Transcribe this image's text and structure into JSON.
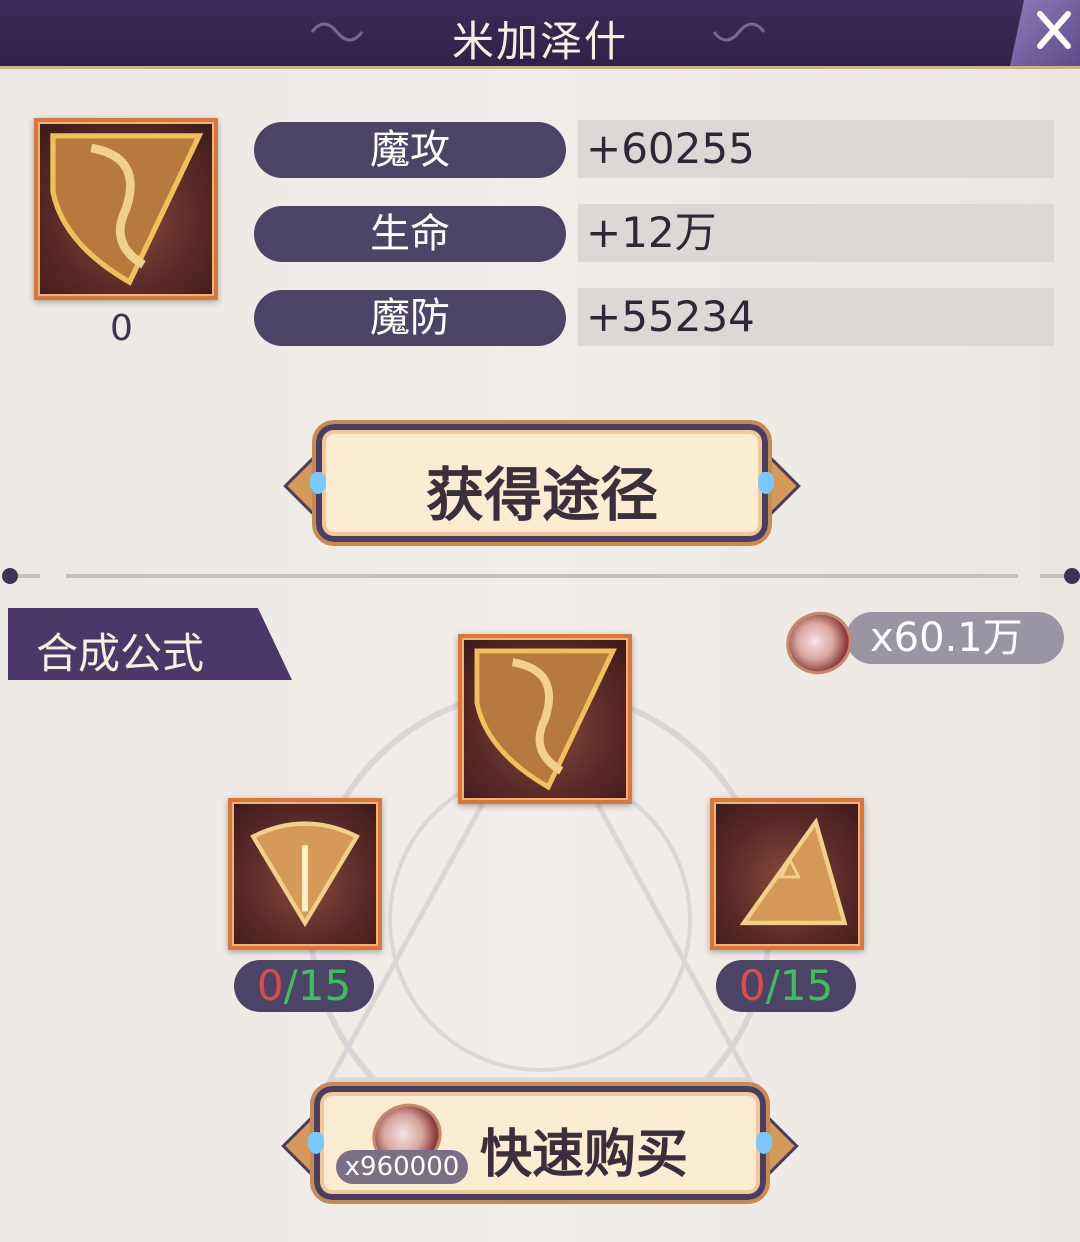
{
  "header": {
    "title": "米加泽什"
  },
  "item": {
    "owned_count": "0"
  },
  "stats": [
    {
      "label": "魔攻",
      "value": "+60255"
    },
    {
      "label": "生命",
      "value": "+12万"
    },
    {
      "label": "魔防",
      "value": "+55234"
    }
  ],
  "buttons": {
    "obtain_label": "获得途径",
    "quick_buy_label": "快速购买",
    "quick_buy_cost": "x960000"
  },
  "section": {
    "title": "合成公式"
  },
  "currency": {
    "amount": "x60.1万"
  },
  "materials": [
    {
      "have": "0",
      "sep": "/",
      "need": "15"
    },
    {
      "have": "0",
      "sep": "/",
      "need": "15"
    }
  ],
  "colors": {
    "header_bg": "#2f2147",
    "badge_bg": "#4b4466",
    "have_red": "#e24a4a",
    "need_green": "#3fbf5c",
    "slot_border": "#d8773c"
  }
}
